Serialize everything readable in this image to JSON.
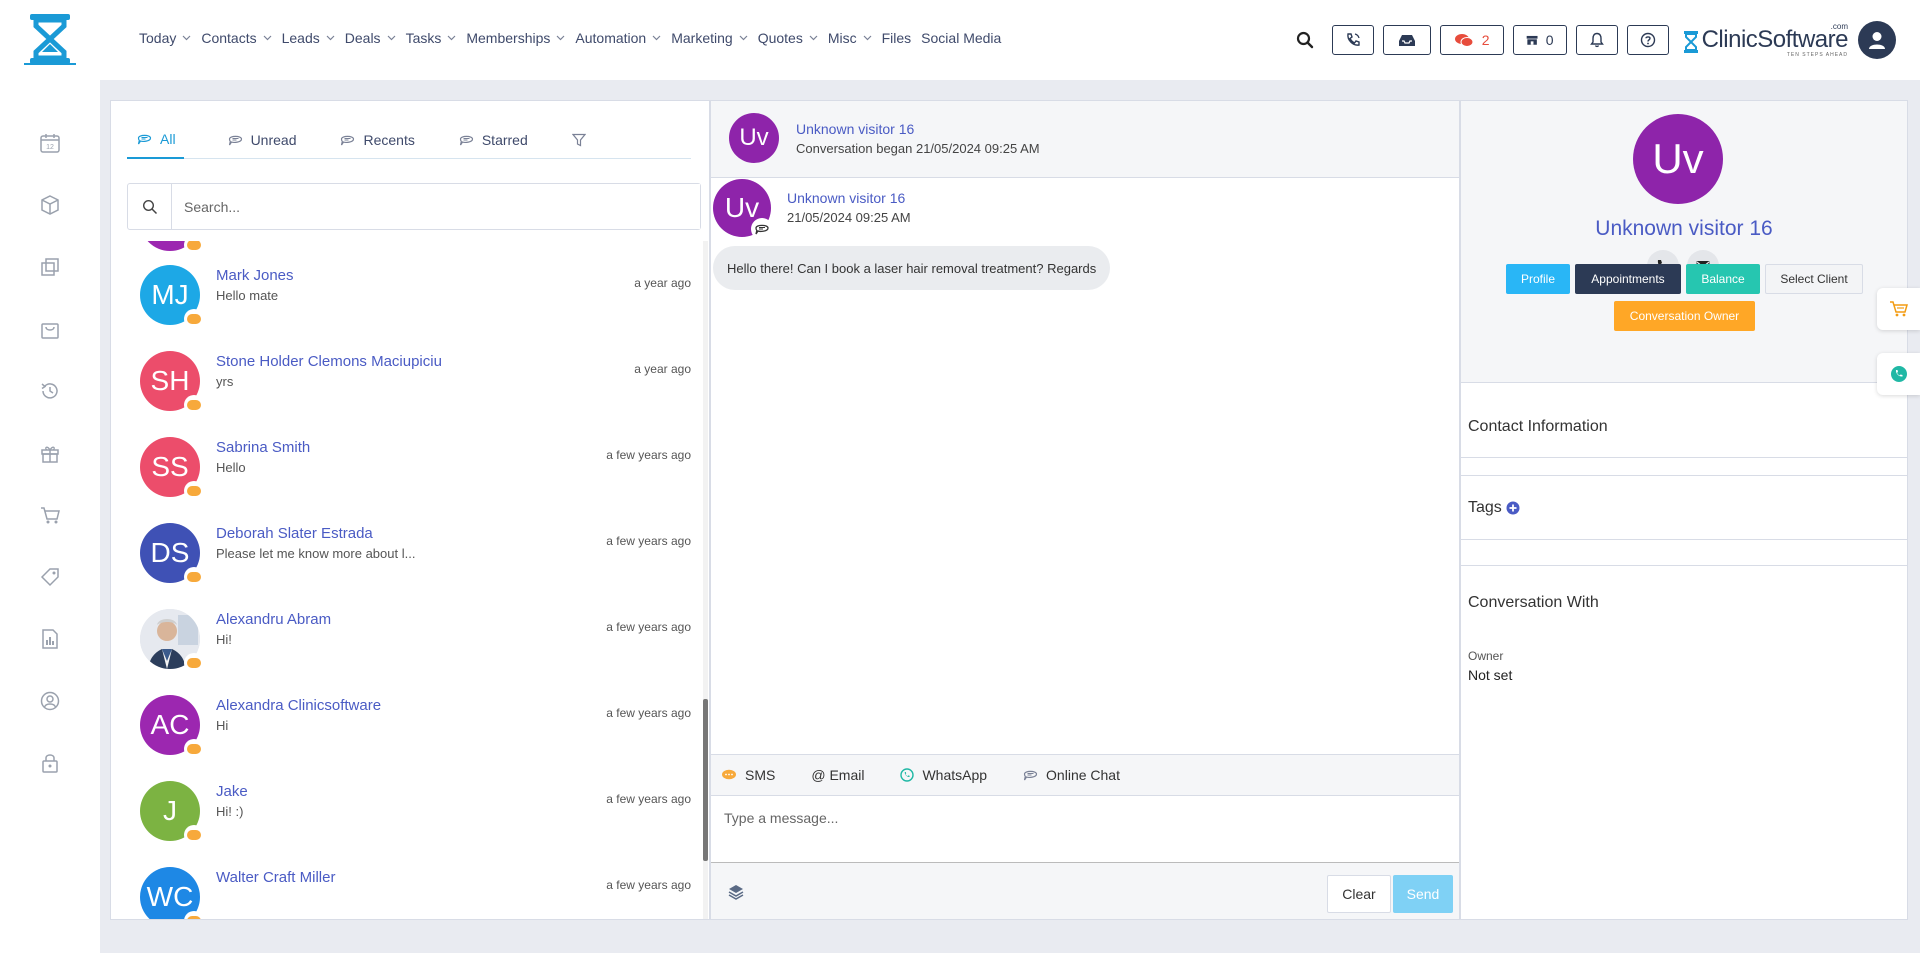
{
  "nav": {
    "items": [
      {
        "label": "Today",
        "has_menu": true
      },
      {
        "label": "Contacts",
        "has_menu": true
      },
      {
        "label": "Leads",
        "has_menu": true
      },
      {
        "label": "Deals",
        "has_menu": true
      },
      {
        "label": "Tasks",
        "has_menu": true
      },
      {
        "label": "Memberships",
        "has_menu": true
      },
      {
        "label": "Automation",
        "has_menu": true
      },
      {
        "label": "Marketing",
        "has_menu": true
      },
      {
        "label": "Quotes",
        "has_menu": true
      },
      {
        "label": "Misc",
        "has_menu": true
      },
      {
        "label": "Files",
        "has_menu": false
      },
      {
        "label": "Social Media",
        "has_menu": false
      }
    ]
  },
  "topbar": {
    "messages_count": "2",
    "store_count": "0",
    "brand_name_part1": "Clinic",
    "brand_name_part2": "Software",
    "brand_com": ".com",
    "brand_tagline": "TEN STEPS AHEAD"
  },
  "list": {
    "tabs": [
      {
        "label": "All",
        "active": true
      },
      {
        "label": "Unread",
        "active": false
      },
      {
        "label": "Recents",
        "active": false
      },
      {
        "label": "Starred",
        "active": false
      }
    ],
    "search_placeholder": "Search...",
    "conversations": [
      {
        "initials": "MJ",
        "name": "Mark Jones",
        "preview": "Hello mate",
        "time": "a year ago",
        "color": "#1da8e6"
      },
      {
        "initials": "SH",
        "name": "Stone Holder Clemons Maciupiciu",
        "preview": "yrs",
        "time": "a year ago",
        "color": "#ec4d6b"
      },
      {
        "initials": "SS",
        "name": "Sabrina Smith",
        "preview": "Hello",
        "time": "a few years ago",
        "color": "#ec4d6b"
      },
      {
        "initials": "DS",
        "name": "Deborah Slater Estrada",
        "preview": "Please let me know more about l...",
        "time": "a few years ago",
        "color": "#3f51b5"
      },
      {
        "initials": "",
        "name": "Alexandru Abram",
        "preview": "Hi!",
        "time": "a few years ago",
        "color": "#dfe3ea"
      },
      {
        "initials": "AC",
        "name": "Alexandra Clinicsoftware",
        "preview": "Hi",
        "time": "a few years ago",
        "color": "#9c27b0"
      },
      {
        "initials": "J",
        "name": "Jake",
        "preview": "Hi! :)",
        "time": "a few years ago",
        "color": "#7cb342"
      },
      {
        "initials": "WC",
        "name": "Walter Craft Miller",
        "preview": "",
        "time": "a few years ago",
        "color": "#1e88e5"
      }
    ]
  },
  "chat": {
    "header_initials": "Uv",
    "header_name": "Unknown visitor 16",
    "header_sub": "Conversation began 21/05/2024 09:25 AM",
    "message": {
      "initials": "Uv",
      "sender": "Unknown visitor 16",
      "date": "21/05/2024 09:25 AM",
      "text": "Hello there! Can I book a laser hair removal treatment? Regards"
    },
    "channels": [
      {
        "label": "SMS",
        "icon": "sms-icon"
      },
      {
        "label": "@ Email",
        "icon": "none"
      },
      {
        "label": "WhatsApp",
        "icon": "whatsapp-icon"
      },
      {
        "label": "Online Chat",
        "icon": "chat-icon"
      }
    ],
    "input_placeholder": "Type a message...",
    "clear_label": "Clear",
    "send_label": "Send"
  },
  "contact": {
    "initials": "Uv",
    "name": "Unknown visitor 16",
    "buttons": {
      "profile": "Profile",
      "appointments": "Appointments",
      "balance": "Balance",
      "select_client": "Select Client",
      "conversation_owner": "Conversation Owner"
    },
    "contact_info_title": "Contact Information",
    "tags_title": "Tags",
    "conversation_with_title": "Conversation With",
    "owner_label": "Owner",
    "owner_value": "Not set"
  },
  "colors": {
    "accent_blue": "#1a9ad6",
    "link_blue": "#4a5bc4",
    "profile_btn": "#29b6f6",
    "appointments_btn": "#2c3a55",
    "balance_btn": "#26c6b0",
    "owner_btn": "#ffa726",
    "send_btn": "#7fd1f5",
    "avatar_purple": "#8e24aa"
  }
}
